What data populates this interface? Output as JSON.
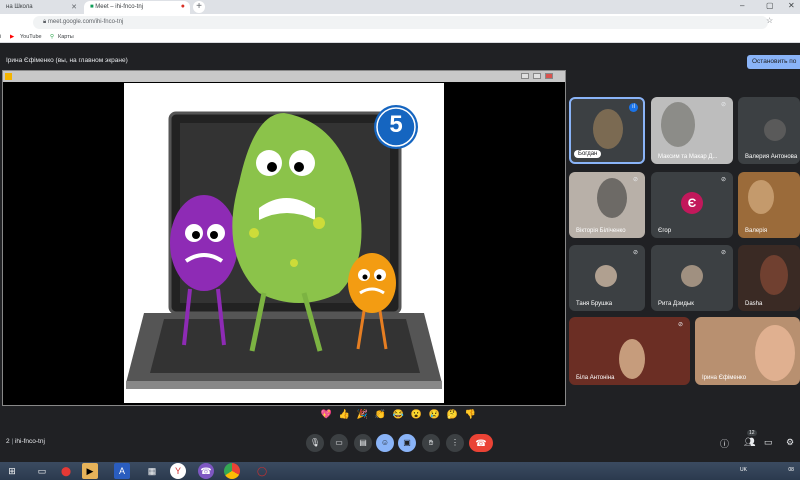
{
  "browser": {
    "tabs": [
      {
        "label": "на Школа"
      },
      {
        "label": "Meet – ihi-fnco-tnj"
      }
    ],
    "url": "meet.google.com/ihi-fnco-tnj",
    "bookmarks": [
      "YouTube",
      "Карты"
    ]
  },
  "meet": {
    "presenter_label": "Ірина Єфіменко (вы, на главном экране)",
    "stop_button": "Остановить по",
    "slide_number": "5",
    "meeting_code": "ihi-fnco-tnj",
    "meeting_prefix": "2",
    "participants": [
      {
        "name": "Богдан",
        "initial": "",
        "color": "#7b6a52"
      },
      {
        "name": "Максим та Макар Д...",
        "initial": "",
        "color": "#8c8c88"
      },
      {
        "name": "Валерия Антонова",
        "initial": "",
        "color": "#5a5a5a"
      },
      {
        "name": "Вікторія Біліченко",
        "initial": "",
        "color": "#6d6a66"
      },
      {
        "name": "Єгор",
        "initial": "Є",
        "color": "#c2185b"
      },
      {
        "name": "Валерія",
        "initial": "",
        "color": "#9b6b3a"
      },
      {
        "name": "Таня Брушка",
        "initial": "",
        "color": "#b0a090"
      },
      {
        "name": "Рита Дзидык",
        "initial": "",
        "color": "#a09080"
      },
      {
        "name": "Dasha",
        "initial": "",
        "color": "#704030"
      },
      {
        "name": "Біла Антоніна",
        "initial": "",
        "color": "#8b4a3a"
      },
      {
        "name": "Ірина Єфіменко",
        "initial": "",
        "color": "#c08060"
      }
    ],
    "reactions": [
      "💖",
      "👍",
      "🎉",
      "👏",
      "😂",
      "😮",
      "😢",
      "🤔",
      "👎"
    ],
    "participants_count": "12",
    "colors": {
      "accent": "#8ab4f8",
      "end_call": "#ea4335",
      "background": "#202124"
    }
  },
  "taskbar": {
    "tray_lang": "UK",
    "tray_time": "08"
  }
}
